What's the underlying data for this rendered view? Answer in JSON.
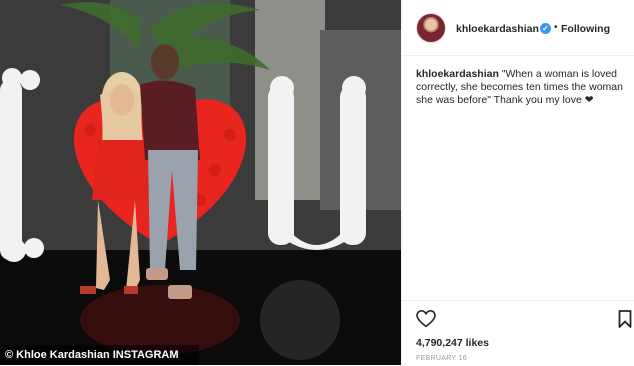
{
  "post": {
    "watermark": "© Khloe Kardashian INSTAGRAM",
    "photo_description": "Couple posing in front of a red heart balloon arch flanked by white balloon letters I and U"
  },
  "header": {
    "username": "khloekardashian",
    "verified_icon": "verified-badge-icon",
    "separator": "•",
    "follow_status": "Following"
  },
  "caption": {
    "username": "khloekardashian",
    "text": "\"When a woman is loved correctly, she becomes ten times the woman she was before\" Thank you my love ❤"
  },
  "actions": {
    "like_icon": "heart-outline-icon",
    "save_icon": "bookmark-icon",
    "likes": "4,790,247 likes",
    "date": "FEBRUARY 16"
  },
  "colors": {
    "verified": "#3897f0",
    "heart_balloons": "#e8251f",
    "dress": "#e0231c",
    "white_balloons": "#f4f4f4"
  }
}
